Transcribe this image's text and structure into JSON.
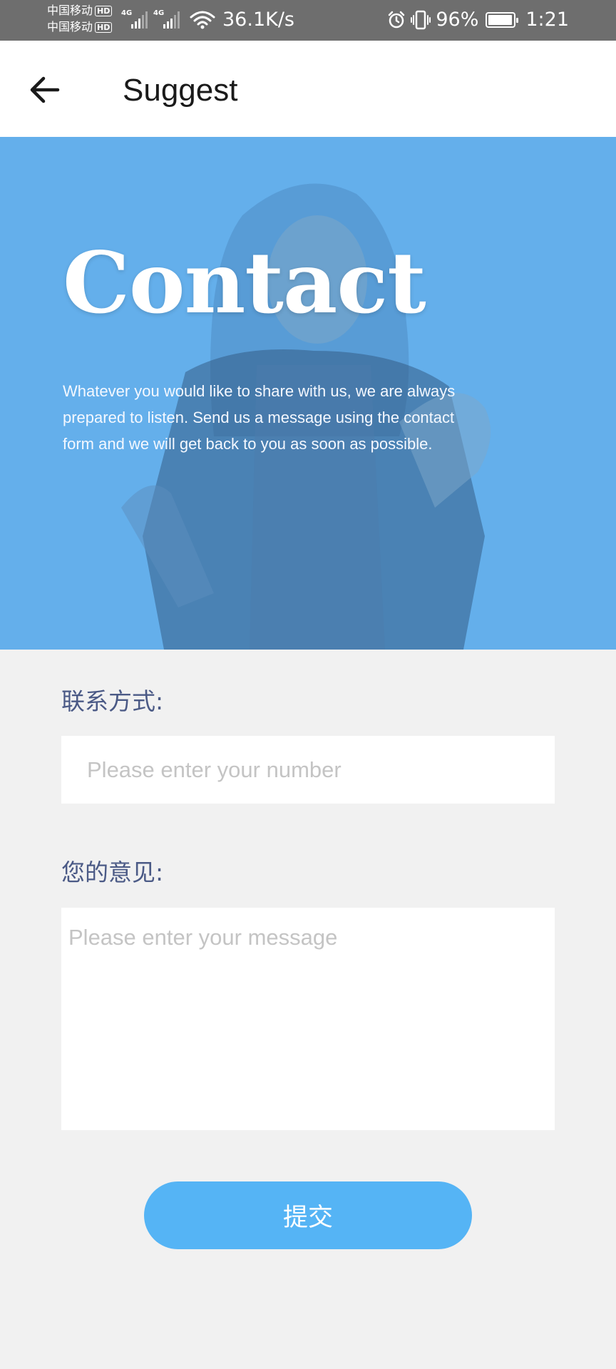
{
  "status_bar": {
    "carrier_1": "中国移动",
    "carrier_2": "中国移动",
    "hd_badge": "HD",
    "network_gen_1": "4G",
    "network_gen_2": "4G",
    "net_speed": "36.1K/s",
    "battery_percent": "96%",
    "battery_level": 0.96,
    "time": "1:21",
    "icons": [
      "signal-icon",
      "wifi-icon",
      "alarm-icon",
      "vibrate-icon",
      "battery-icon"
    ]
  },
  "header": {
    "title": "Suggest",
    "back_icon": "arrow-left-icon"
  },
  "hero": {
    "title": "Contact",
    "description": "Whatever you would like to share with us, we are always prepared to listen. Send us a message using the contact form and we will get back to you as soon as possible.",
    "background_color": "#64afeb"
  },
  "form": {
    "contact_label": "联系方式:",
    "contact_placeholder": "Please enter your number",
    "contact_value": "",
    "message_label": "您的意见:",
    "message_placeholder": "Please enter your message",
    "message_value": "",
    "submit_label": "提交",
    "accent_color": "#55b4f5"
  }
}
